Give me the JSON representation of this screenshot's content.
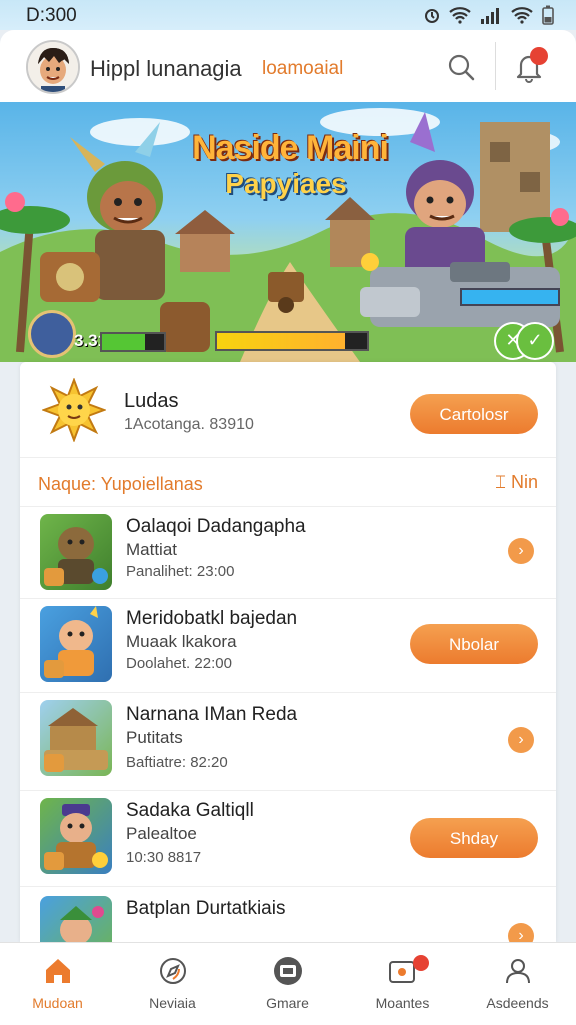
{
  "status_bar": {
    "time": "D:300"
  },
  "header": {
    "title": "Hippl lunanagia",
    "subtitle": "loamoaial",
    "avatar_icon": "user-avatar-icon",
    "search_icon": "search-icon",
    "notification_icon": "bell-icon"
  },
  "banner": {
    "title": "Naside Maini",
    "subtitle": "Papyiaes",
    "player_score": "3.315",
    "health_percent": 70,
    "experience_percent": 85,
    "enemy_bar_percent": 100
  },
  "promo": {
    "title": "Ludas",
    "meta": "1Acotanga. 83910",
    "button": "Cartolosr"
  },
  "section": {
    "title": "Naque: Yupoiellanas",
    "more": "Nin"
  },
  "items": [
    {
      "title": "Oalaqoi Dadangapha",
      "subtitle": "Mattiat",
      "meta": "Panalihet: 23:00",
      "action": "chevron"
    },
    {
      "title": "Meridobatkl bajedan",
      "subtitle": "Muaak lkakora",
      "meta": "Doolahet. 22:00",
      "action": "Nbolar"
    },
    {
      "title": "Narnana IMan Reda",
      "subtitle": "Putitats",
      "meta": "Baftiatre: 82:20",
      "action": "chevron"
    },
    {
      "title": "Sadaka Galtiqll",
      "subtitle": "Palealtoe",
      "meta": "10:30       8817",
      "action": "Shday"
    },
    {
      "title": "Batplan Durtatkiais",
      "subtitle": "",
      "meta": "",
      "action": "chevron"
    }
  ],
  "nav": [
    {
      "label": "Mudoan",
      "icon": "home-icon",
      "active": true
    },
    {
      "label": "Neviaia",
      "icon": "compass-icon",
      "active": false
    },
    {
      "label": "Gmare",
      "icon": "game-icon",
      "active": false
    },
    {
      "label": "Moantes",
      "icon": "message-icon",
      "active": false
    },
    {
      "label": "Asdeends",
      "icon": "profile-icon",
      "active": false
    }
  ],
  "colors": {
    "accent": "#ec7b2e",
    "badge": "#e64233",
    "banner_sky": "#59b4e8"
  }
}
